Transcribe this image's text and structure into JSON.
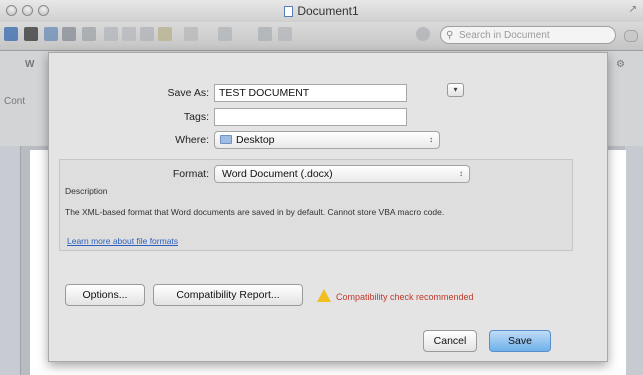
{
  "window": {
    "title": "Document1"
  },
  "toolbar": {
    "search_placeholder": "Search in Document"
  },
  "ribbon": {
    "labels": [
      "Cont",
      "W"
    ]
  },
  "dialog": {
    "save_as_label": "Save As:",
    "save_as_value": "TEST DOCUMENT",
    "tags_label": "Tags:",
    "tags_value": "",
    "where_label": "Where:",
    "where_value": "Desktop",
    "format_label": "Format:",
    "format_value": "Word Document (.docx)",
    "description_title": "Description",
    "description_text": "The XML-based format that Word documents are saved in by default. Cannot store VBA macro code.",
    "learn_more_link": "Learn more about file formats",
    "options_button": "Options...",
    "compat_button": "Compatibility Report...",
    "warning_text": "Compatibility check recommended",
    "cancel_button": "Cancel",
    "save_button": "Save"
  }
}
